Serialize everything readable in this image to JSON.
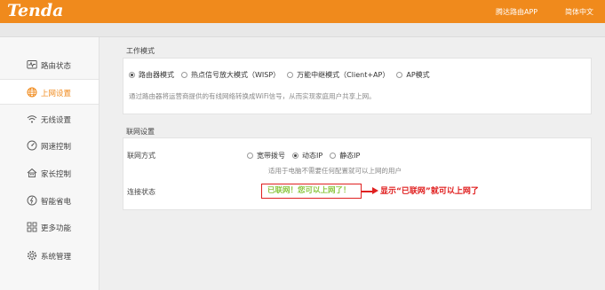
{
  "header": {
    "logo": "Tenda",
    "app_link": "腾达路由APP",
    "language": "简体中文"
  },
  "sidebar": {
    "items": [
      {
        "label": "路由状态",
        "icon": "pulse-monitor-icon"
      },
      {
        "label": "上网设置",
        "icon": "globe-icon",
        "active": true
      },
      {
        "label": "无线设置",
        "icon": "wifi-icon"
      },
      {
        "label": "网速控制",
        "icon": "speedometer-icon"
      },
      {
        "label": "家长控制",
        "icon": "home-family-icon"
      },
      {
        "label": "智能省电",
        "icon": "power-saving-icon"
      },
      {
        "label": "更多功能",
        "icon": "grid-icon"
      },
      {
        "label": "系统管理",
        "icon": "gear-icon"
      }
    ]
  },
  "work_mode": {
    "title": "工作模式",
    "options": [
      "路由器模式",
      "热点信号放大模式（WISP）",
      "万能中继模式（Client+AP）",
      "AP模式"
    ],
    "selected_index": 0,
    "description": "通过路由器将运营商提供的有线网络转换成WiFi信号，从而实现家庭用户共享上网。"
  },
  "network": {
    "title": "联网设置",
    "mode_label": "联网方式",
    "mode_options": [
      "宽带拨号",
      "动态IP",
      "静态IP"
    ],
    "mode_selected_index": 1,
    "mode_hint": "适用于电脑不需要任何配置就可以上网的用户",
    "status_label": "连接状态",
    "status_value": "已联网！您可以上网了！"
  },
  "annotation": {
    "text": "显示“已联网”就可以上网了",
    "color": "#e02020"
  },
  "colors": {
    "brand": "#f08a1c",
    "status_ok": "#8cc63f"
  }
}
